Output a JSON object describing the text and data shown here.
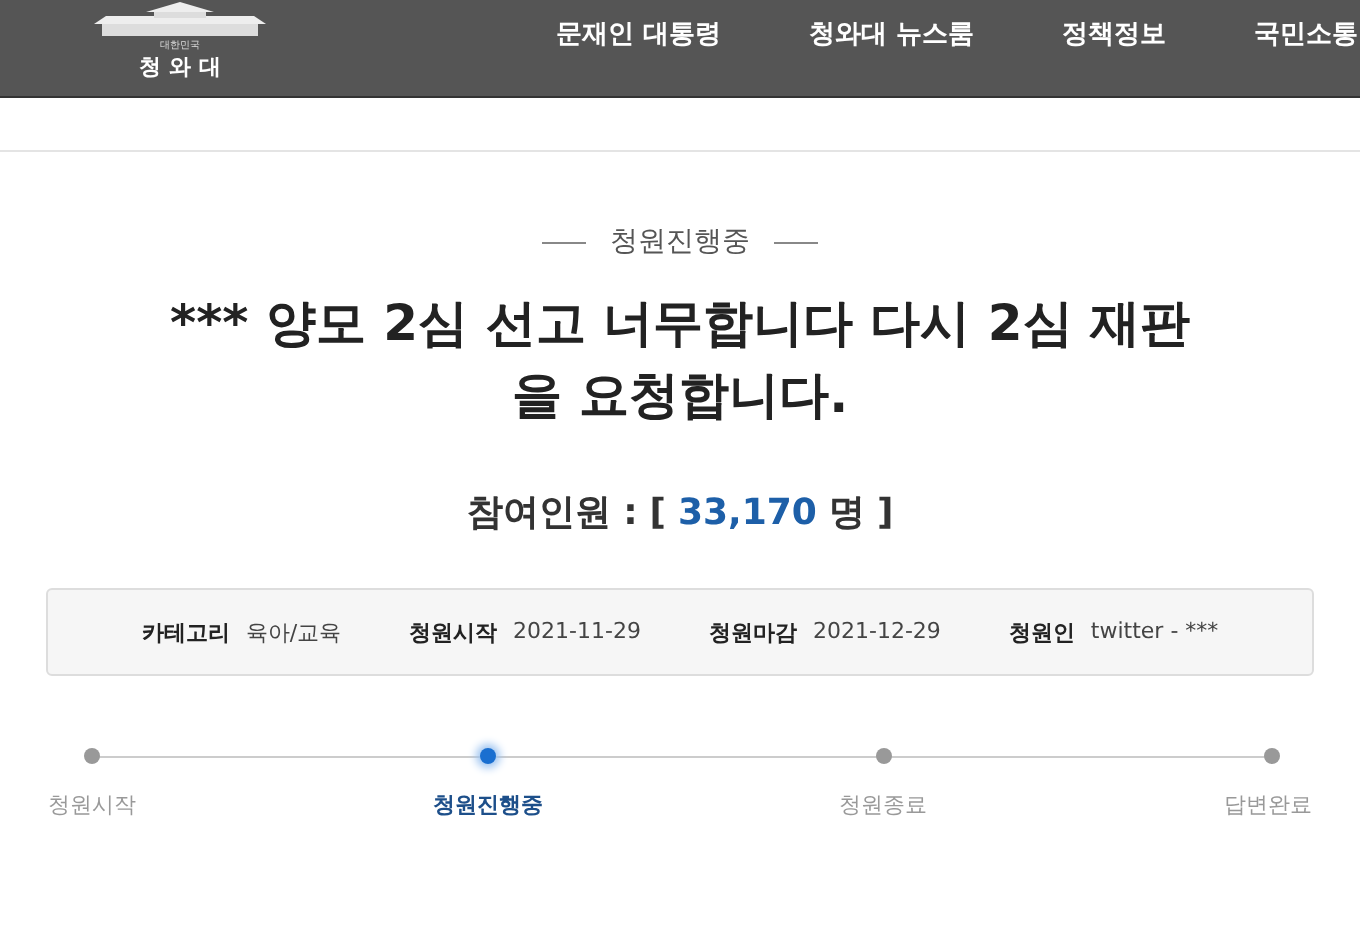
{
  "header": {
    "logo": {
      "subtitle": "대한민국",
      "name": "청 와 대"
    },
    "nav": [
      "문재인 대통령",
      "청와대 뉴스룸",
      "정책정보",
      "국민소통"
    ]
  },
  "petition": {
    "status": "청원진행중",
    "title": "*** 양모 2심 선고 너무합니다 다시 2심 재판 을 요청합니다.",
    "participants": {
      "label": "참여인원 :",
      "open": "[",
      "count": "33,170",
      "unit": "명",
      "close": "]"
    },
    "info": [
      {
        "label": "카테고리",
        "value": "육아/교육"
      },
      {
        "label": "청원시작",
        "value": "2021-11-29"
      },
      {
        "label": "청원마감",
        "value": "2021-12-29"
      },
      {
        "label": "청원인",
        "value": "twitter - ***"
      }
    ],
    "steps": [
      {
        "label": "청원시작",
        "selected": false
      },
      {
        "label": "청원진행중",
        "selected": true
      },
      {
        "label": "청원종료",
        "selected": false
      },
      {
        "label": "답변완료",
        "selected": false
      }
    ]
  }
}
